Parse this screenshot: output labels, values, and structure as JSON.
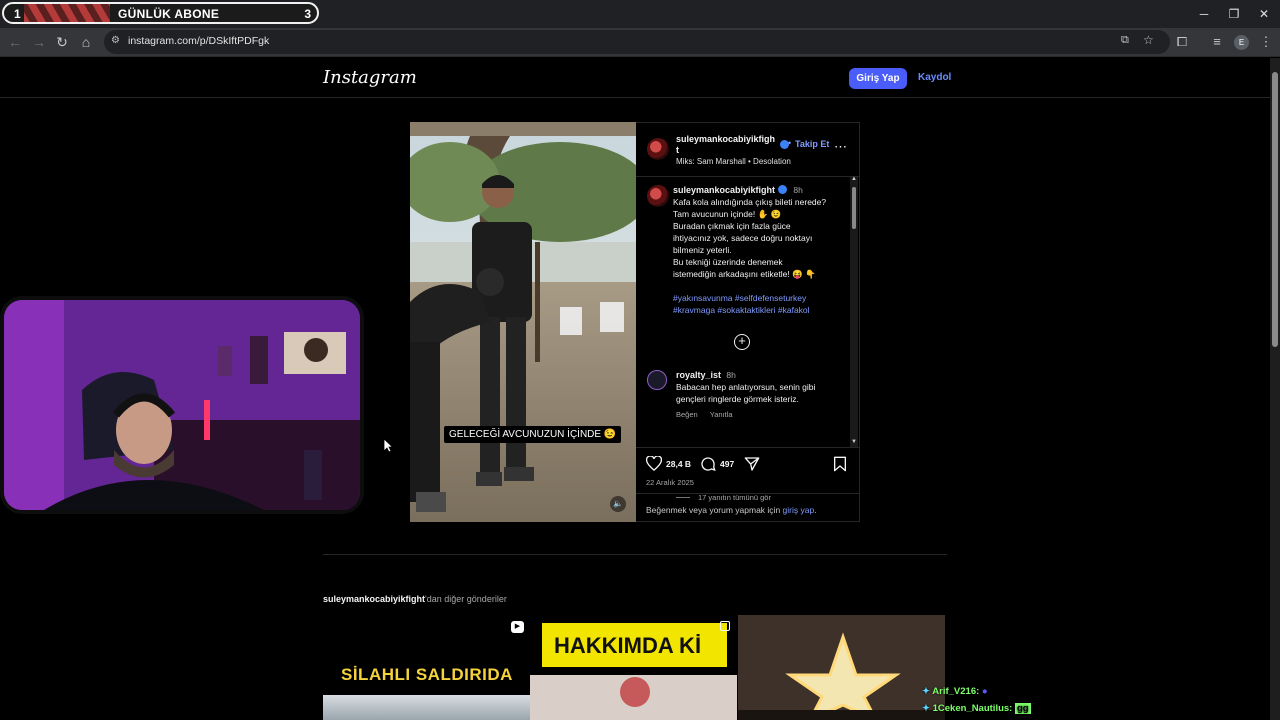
{
  "overlay": {
    "goal_current": "1",
    "goal_label": "GÜNLÜK ABONE",
    "goal_target": "3"
  },
  "browser": {
    "url": "instagram.com/p/DSkIftPDFgk",
    "profile_initial": "E"
  },
  "instagram": {
    "logo": "Instagram",
    "login": "Giriş Yap",
    "signup": "Kaydol",
    "post": {
      "username_line1": "suleymankocabiyikfigh",
      "username_line2": "t",
      "follow": "Takip Et",
      "audio": "Miks: Sam Marshall • Desolation",
      "caption_user": "suleymankocabiyikfight",
      "caption_time": "8h",
      "caption_lines": [
        "Kafa kola alındığında çıkış bileti nerede?",
        "Tam avucunun içinde! ✋ 😉",
        "Buradan çıkmak için fazla güce",
        "ihtiyacınız yok, sadece doğru noktayı",
        "bilmeniz yeterli.",
        "Bu tekniği üzerinde denemek",
        "istemediğin arkadaşını etiketle! 😝 👇"
      ],
      "hashtags_line1": "#yakınsavunma #selfdefenseturkey",
      "hashtags_line2": "#kravmaga #sokaktaktikleri #kafakol",
      "comment_user": "royalty_ist",
      "comment_time": "8h",
      "comment_line1": "Babacan hep anlatıyorsun, senin gibi",
      "comment_line2": "gençleri ringlerde görmek isteriz.",
      "comment_like": "Beğen",
      "comment_reply": "Yanıtla",
      "view_replies": "17 yanıtın tümünü gör",
      "likes": "28,4 B",
      "comments": "497",
      "date": "22 Aralık 2025",
      "login_prompt_pre": "Beğenmek veya yorum yapmak için ",
      "login_prompt_link": "giriş yap",
      "login_prompt_post": ".",
      "video_caption": "GELECEĞİ AVCUNUZUN İÇİNDE 😉"
    },
    "more_user": "suleymankocabiyikfight",
    "more_suffix": "'dan diğer gönderiler",
    "thumbs": [
      {
        "text": "SİLAHLI SALDIRIDA"
      },
      {
        "text": "HAKKIMDA Kİ"
      },
      {
        "text": ""
      }
    ]
  },
  "chat": [
    {
      "user": "Arif_V216:",
      "msg": ""
    },
    {
      "user": "1Ceken_Nautilus:",
      "msg": "gg"
    }
  ]
}
